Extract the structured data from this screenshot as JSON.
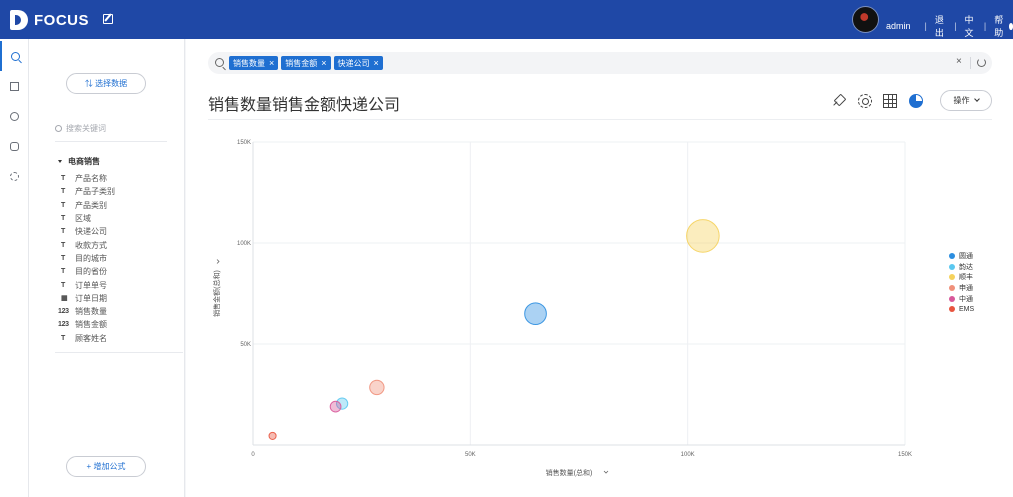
{
  "app": {
    "logo_text": "FOCUS",
    "user": "admin",
    "links": [
      "退出",
      "中文",
      "帮助"
    ]
  },
  "left_panel": {
    "select_data_label": "⇅ 选择数据",
    "keyword_placeholder": "搜索关键词",
    "tree_root": "电商销售",
    "fields": [
      {
        "type": "T",
        "label": "产品名称"
      },
      {
        "type": "T",
        "label": "产品子类别"
      },
      {
        "type": "T",
        "label": "产品类别"
      },
      {
        "type": "T",
        "label": "区域"
      },
      {
        "type": "T",
        "label": "快递公司"
      },
      {
        "type": "T",
        "label": "收款方式"
      },
      {
        "type": "T",
        "label": "目的城市"
      },
      {
        "type": "T",
        "label": "目的省份"
      },
      {
        "type": "T",
        "label": "订单单号"
      },
      {
        "type": "date",
        "label": "订单日期"
      },
      {
        "type": "123",
        "label": "销售数量"
      },
      {
        "type": "123",
        "label": "销售金额"
      },
      {
        "type": "T",
        "label": "顾客姓名"
      }
    ],
    "add_formula_label": "+ 增加公式"
  },
  "search": {
    "tags": [
      "销售数量",
      "销售金额",
      "快递公司"
    ]
  },
  "main": {
    "title": "销售数量销售金额快递公司",
    "operate_label": "操作"
  },
  "chart_data": {
    "type": "scatter",
    "xlabel": "销售数量(总和)",
    "ylabel": "销售金额(总和)",
    "xlim": [
      0,
      150000
    ],
    "ylim": [
      0,
      150000
    ],
    "xticks": [
      "0",
      "50K",
      "100K",
      "150K"
    ],
    "yticks": [
      "50K",
      "100K",
      "150K"
    ],
    "grid": true,
    "legend_position": "right",
    "series": [
      {
        "name": "圆通",
        "color": "#2c8ee0",
        "x": 65000,
        "y": 65000,
        "size": 3.4
      },
      {
        "name": "韵达",
        "color": "#5bc8f0",
        "x": 20500,
        "y": 20500,
        "size": 1.4
      },
      {
        "name": "顺丰",
        "color": "#f5d25c",
        "x": 103500,
        "y": 103500,
        "size": 5.5
      },
      {
        "name": "申通",
        "color": "#f0907a",
        "x": 28500,
        "y": 28500,
        "size": 2.0
      },
      {
        "name": "中通",
        "color": "#d8589a",
        "x": 19000,
        "y": 19000,
        "size": 1.3
      },
      {
        "name": "EMS",
        "color": "#e8543e",
        "x": 4500,
        "y": 4500,
        "size": 0.6
      }
    ]
  }
}
